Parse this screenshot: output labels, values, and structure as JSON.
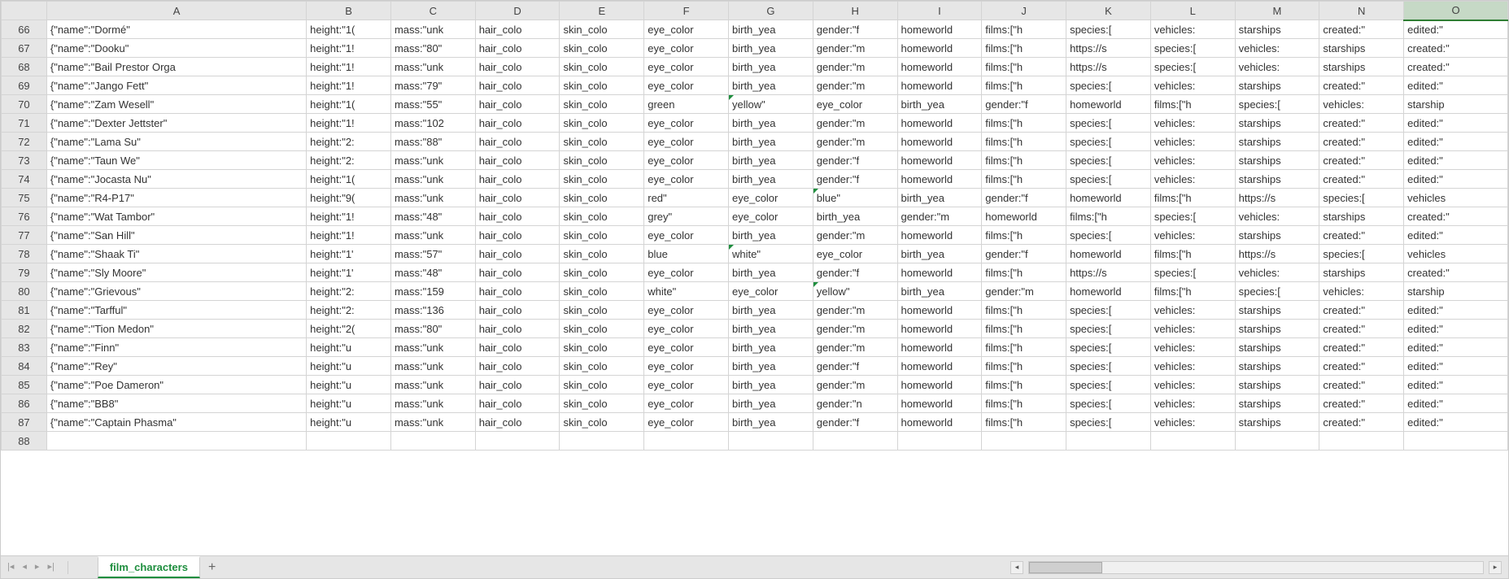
{
  "sheet_tab": "film_characters",
  "selected_column": "O",
  "columns": [
    "A",
    "B",
    "C",
    "D",
    "E",
    "F",
    "G",
    "H",
    "I",
    "J",
    "K",
    "L",
    "M",
    "N",
    "O"
  ],
  "row_start": 66,
  "rows": [
    {
      "n": 66,
      "A": "{\"name\":\"Dormé\"",
      "B": "height:\"1(",
      "C": "mass:\"unk",
      "D": "hair_colo",
      "E": "skin_colo",
      "F": "eye_color",
      "G": "birth_yea",
      "H": "gender:\"f",
      "I": "homeworld",
      "J": "films:[\"h",
      "K": "species:[",
      "L": "vehicles:",
      "M": "starships",
      "N": "created:\"",
      "O": "edited:\""
    },
    {
      "n": 67,
      "A": "{\"name\":\"Dooku\"",
      "B": "height:\"1!",
      "C": "mass:\"80\"",
      "D": "hair_colo",
      "E": "skin_colo",
      "F": "eye_color",
      "G": "birth_yea",
      "H": "gender:\"m",
      "I": "homeworld",
      "J": "films:[\"h",
      "K": "https://s",
      "L": "species:[",
      "M": "vehicles:",
      "N": "starships",
      "O": "created:\""
    },
    {
      "n": 68,
      "A": "{\"name\":\"Bail Prestor Orga",
      "B": "height:\"1!",
      "C": "mass:\"unk",
      "D": "hair_colo",
      "E": "skin_colo",
      "F": "eye_color",
      "G": "birth_yea",
      "H": "gender:\"m",
      "I": "homeworld",
      "J": "films:[\"h",
      "K": "https://s",
      "L": "species:[",
      "M": "vehicles:",
      "N": "starships",
      "O": "created:\""
    },
    {
      "n": 69,
      "A": "{\"name\":\"Jango Fett\"",
      "B": "height:\"1!",
      "C": "mass:\"79\"",
      "D": "hair_colo",
      "E": "skin_colo",
      "F": "eye_color",
      "G": "birth_yea",
      "H": "gender:\"m",
      "I": "homeworld",
      "J": "films:[\"h",
      "K": "species:[",
      "L": "vehicles:",
      "M": "starships",
      "N": "created:\"",
      "O": "edited:\""
    },
    {
      "n": 70,
      "A": "{\"name\":\"Zam Wesell\"",
      "B": "height:\"1(",
      "C": "mass:\"55\"",
      "D": "hair_colo",
      "E": "skin_colo",
      "F": " green",
      "G": " yellow\"",
      "H": "eye_color",
      "I": "birth_yea",
      "J": "gender:\"f",
      "K": "homeworld",
      "L": "films:[\"h",
      "M": "species:[",
      "N": "vehicles:",
      "O": "starship"
    },
    {
      "n": 71,
      "A": "{\"name\":\"Dexter Jettster\"",
      "B": "height:\"1!",
      "C": "mass:\"102",
      "D": "hair_colo",
      "E": "skin_colo",
      "F": "eye_color",
      "G": "birth_yea",
      "H": "gender:\"m",
      "I": "homeworld",
      "J": "films:[\"h",
      "K": "species:[",
      "L": "vehicles:",
      "M": "starships",
      "N": "created:\"",
      "O": "edited:\""
    },
    {
      "n": 72,
      "A": "{\"name\":\"Lama Su\"",
      "B": "height:\"2:",
      "C": "mass:\"88\"",
      "D": "hair_colo",
      "E": "skin_colo",
      "F": "eye_color",
      "G": "birth_yea",
      "H": "gender:\"m",
      "I": "homeworld",
      "J": "films:[\"h",
      "K": "species:[",
      "L": "vehicles:",
      "M": "starships",
      "N": "created:\"",
      "O": "edited:\""
    },
    {
      "n": 73,
      "A": "{\"name\":\"Taun We\"",
      "B": "height:\"2:",
      "C": "mass:\"unk",
      "D": "hair_colo",
      "E": "skin_colo",
      "F": "eye_color",
      "G": "birth_yea",
      "H": "gender:\"f",
      "I": "homeworld",
      "J": "films:[\"h",
      "K": "species:[",
      "L": "vehicles:",
      "M": "starships",
      "N": "created:\"",
      "O": "edited:\""
    },
    {
      "n": 74,
      "A": "{\"name\":\"Jocasta Nu\"",
      "B": "height:\"1(",
      "C": "mass:\"unk",
      "D": "hair_colo",
      "E": "skin_colo",
      "F": "eye_color",
      "G": "birth_yea",
      "H": "gender:\"f",
      "I": "homeworld",
      "J": "films:[\"h",
      "K": "species:[",
      "L": "vehicles:",
      "M": "starships",
      "N": "created:\"",
      "O": "edited:\""
    },
    {
      "n": 75,
      "A": "{\"name\":\"R4-P17\"",
      "B": "height:\"9(",
      "C": "mass:\"unk",
      "D": "hair_colo",
      "E": "skin_colo",
      "F": " red\"",
      "G": "eye_color",
      "H": " blue\"",
      "I": "birth_yea",
      "J": "gender:\"f",
      "K": "homeworld",
      "L": "films:[\"h",
      "M": "https://s",
      "N": "species:[",
      "O": "vehicles"
    },
    {
      "n": 76,
      "A": "{\"name\":\"Wat Tambor\"",
      "B": "height:\"1!",
      "C": "mass:\"48\"",
      "D": "hair_colo",
      "E": "skin_colo",
      "F": " grey\"",
      "G": "eye_color",
      "H": "birth_yea",
      "I": "gender:\"m",
      "J": "homeworld",
      "K": "films:[\"h",
      "L": "species:[",
      "M": "vehicles:",
      "N": "starships",
      "O": "created:\""
    },
    {
      "n": 77,
      "A": "{\"name\":\"San Hill\"",
      "B": "height:\"1!",
      "C": "mass:\"unk",
      "D": "hair_colo",
      "E": "skin_colo",
      "F": "eye_color",
      "G": "birth_yea",
      "H": "gender:\"m",
      "I": "homeworld",
      "J": "films:[\"h",
      "K": "species:[",
      "L": "vehicles:",
      "M": "starships",
      "N": "created:\"",
      "O": "edited:\""
    },
    {
      "n": 78,
      "A": "{\"name\":\"Shaak Ti\"",
      "B": "height:\"1'",
      "C": "mass:\"57\"",
      "D": "hair_colo",
      "E": "skin_colo",
      "F": " blue",
      "G": " white\"",
      "H": "eye_color",
      "I": "birth_yea",
      "J": "gender:\"f",
      "K": "homeworld",
      "L": "films:[\"h",
      "M": "https://s",
      "N": "species:[",
      "O": "vehicles"
    },
    {
      "n": 79,
      "A": "{\"name\":\"Sly Moore\"",
      "B": "height:\"1'",
      "C": "mass:\"48\"",
      "D": "hair_colo",
      "E": "skin_colo",
      "F": "eye_color",
      "G": "birth_yea",
      "H": "gender:\"f",
      "I": "homeworld",
      "J": "films:[\"h",
      "K": "https://s",
      "L": "species:[",
      "M": "vehicles:",
      "N": "starships",
      "O": "created:\""
    },
    {
      "n": 80,
      "A": "{\"name\":\"Grievous\"",
      "B": "height:\"2:",
      "C": "mass:\"159",
      "D": "hair_colo",
      "E": "skin_colo",
      "F": " white\"",
      "G": "eye_color",
      "H": " yellow\"",
      "I": "birth_yea",
      "J": "gender:\"m",
      "K": "homeworld",
      "L": "films:[\"h",
      "M": "species:[",
      "N": "vehicles:",
      "O": "starship"
    },
    {
      "n": 81,
      "A": "{\"name\":\"Tarfful\"",
      "B": "height:\"2:",
      "C": "mass:\"136",
      "D": "hair_colo",
      "E": "skin_colo",
      "F": "eye_color",
      "G": "birth_yea",
      "H": "gender:\"m",
      "I": "homeworld",
      "J": "films:[\"h",
      "K": "species:[",
      "L": "vehicles:",
      "M": "starships",
      "N": "created:\"",
      "O": "edited:\""
    },
    {
      "n": 82,
      "A": "{\"name\":\"Tion Medon\"",
      "B": "height:\"2(",
      "C": "mass:\"80\"",
      "D": "hair_colo",
      "E": "skin_colo",
      "F": "eye_color",
      "G": "birth_yea",
      "H": "gender:\"m",
      "I": "homeworld",
      "J": "films:[\"h",
      "K": "species:[",
      "L": "vehicles:",
      "M": "starships",
      "N": "created:\"",
      "O": "edited:\""
    },
    {
      "n": 83,
      "A": "{\"name\":\"Finn\"",
      "B": "height:\"u",
      "C": "mass:\"unk",
      "D": "hair_colo",
      "E": "skin_colo",
      "F": "eye_color",
      "G": "birth_yea",
      "H": "gender:\"m",
      "I": "homeworld",
      "J": "films:[\"h",
      "K": "species:[",
      "L": "vehicles:",
      "M": "starships",
      "N": "created:\"",
      "O": "edited:\""
    },
    {
      "n": 84,
      "A": "{\"name\":\"Rey\"",
      "B": "height:\"u",
      "C": "mass:\"unk",
      "D": "hair_colo",
      "E": "skin_colo",
      "F": "eye_color",
      "G": "birth_yea",
      "H": "gender:\"f",
      "I": "homeworld",
      "J": "films:[\"h",
      "K": "species:[",
      "L": "vehicles:",
      "M": "starships",
      "N": "created:\"",
      "O": "edited:\""
    },
    {
      "n": 85,
      "A": "{\"name\":\"Poe Dameron\"",
      "B": "height:\"u",
      "C": "mass:\"unk",
      "D": "hair_colo",
      "E": "skin_colo",
      "F": "eye_color",
      "G": "birth_yea",
      "H": "gender:\"m",
      "I": "homeworld",
      "J": "films:[\"h",
      "K": "species:[",
      "L": "vehicles:",
      "M": "starships",
      "N": "created:\"",
      "O": "edited:\""
    },
    {
      "n": 86,
      "A": "{\"name\":\"BB8\"",
      "B": "height:\"u",
      "C": "mass:\"unk",
      "D": "hair_colo",
      "E": "skin_colo",
      "F": "eye_color",
      "G": "birth_yea",
      "H": "gender:\"n",
      "I": "homeworld",
      "J": "films:[\"h",
      "K": "species:[",
      "L": "vehicles:",
      "M": "starships",
      "N": "created:\"",
      "O": "edited:\""
    },
    {
      "n": 87,
      "A": "{\"name\":\"Captain Phasma\"",
      "B": "height:\"u",
      "C": "mass:\"unk",
      "D": "hair_colo",
      "E": "skin_colo",
      "F": "eye_color",
      "G": "birth_yea",
      "H": "gender:\"f",
      "I": "homeworld",
      "J": "films:[\"h",
      "K": "species:[",
      "L": "vehicles:",
      "M": "starships",
      "N": "created:\"",
      "O": "edited:\""
    },
    {
      "n": 88,
      "A": "",
      "B": "",
      "C": "",
      "D": "",
      "E": "",
      "F": "",
      "G": "",
      "H": "",
      "I": "",
      "J": "",
      "K": "",
      "L": "",
      "M": "",
      "N": "",
      "O": ""
    }
  ],
  "green_triangle_cells": [
    {
      "row": 70,
      "col": "G"
    },
    {
      "row": 75,
      "col": "H"
    },
    {
      "row": 78,
      "col": "G"
    },
    {
      "row": 80,
      "col": "H"
    }
  ]
}
